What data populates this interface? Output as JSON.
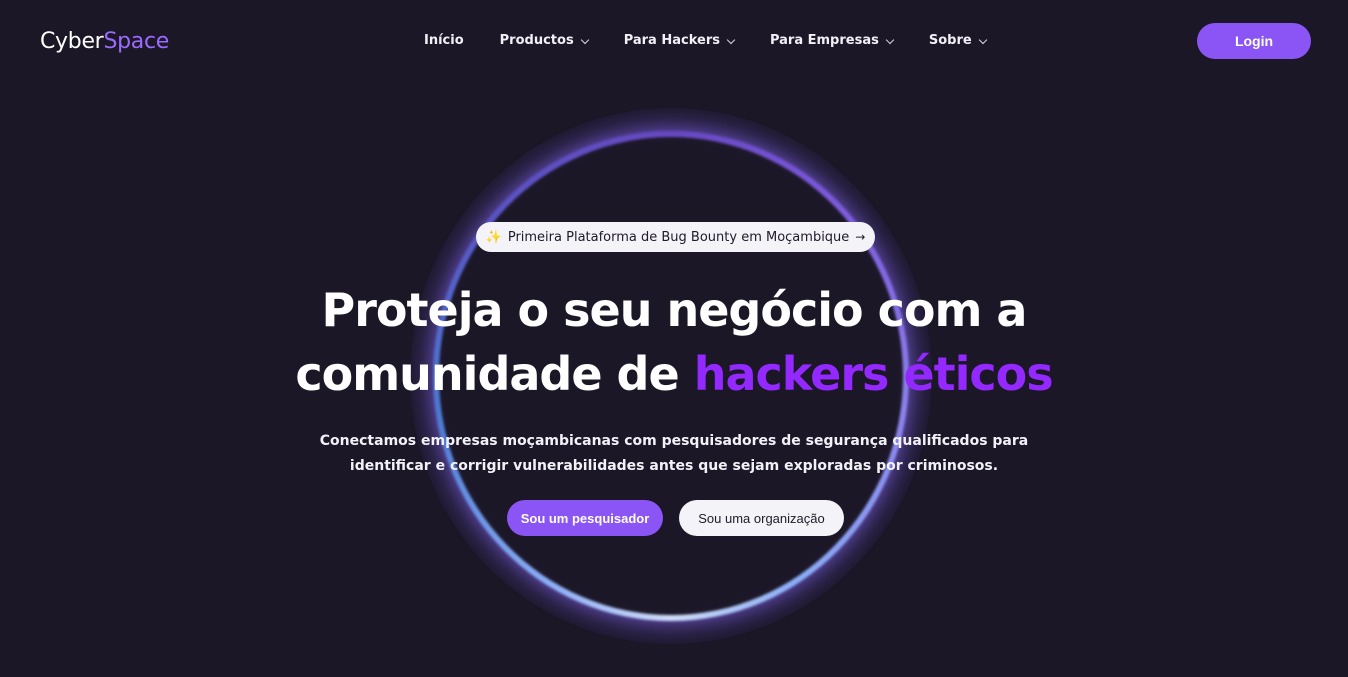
{
  "header": {
    "logo_part1": "Cyber",
    "logo_part2": "Space",
    "nav": [
      {
        "label": "Início",
        "has_dropdown": false
      },
      {
        "label": "Productos",
        "has_dropdown": true
      },
      {
        "label": "Para Hackers",
        "has_dropdown": true
      },
      {
        "label": "Para Empresas",
        "has_dropdown": true
      },
      {
        "label": "Sobre",
        "has_dropdown": true
      }
    ],
    "login_label": "Login"
  },
  "hero": {
    "badge_icon": "sparkles-icon",
    "badge_text": "Primeira Plataforma de Bug Bounty em Moçambique",
    "badge_arrow": "→",
    "headline_line1": "Proteja o seu negócio com a",
    "headline_line2_plain": "comunidade de",
    "headline_line2_accent": "hackers éticos",
    "subtitle_line1": "Conectamos empresas moçambicanas com pesquisadores de segurança qualificados para",
    "subtitle_line2": "identificar e corrigir vulnerabilidades antes que sejam exploradas por criminosos.",
    "cta_primary": "Sou um pesquisador",
    "cta_secondary": "Sou uma organização"
  },
  "colors": {
    "background": "#1b1726",
    "accent": "#8b55f5",
    "headline_accent": "#9328ff",
    "logo_accent": "#9b6bff"
  }
}
